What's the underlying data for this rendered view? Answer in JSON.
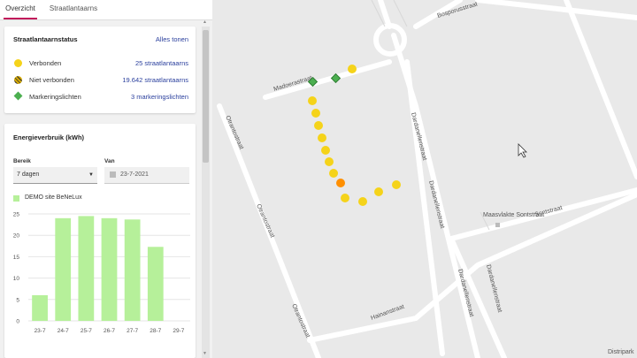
{
  "tabs": [
    {
      "label": "Overzicht",
      "active": true
    },
    {
      "label": "Straatlantaarns",
      "active": false
    }
  ],
  "status": {
    "title": "Straatlantaarnstatus",
    "show_all": "Alles tonen",
    "rows": [
      {
        "label": "Verbonden",
        "value": "25 straatlantaarns",
        "color": "#f5d31a"
      },
      {
        "label": "Niet verbonden",
        "value": "19.642 straatlantaarns",
        "color": "#c9a400"
      },
      {
        "label": "Markeringslichten",
        "value": "3 markeringslichten",
        "color": "#4caf50"
      }
    ]
  },
  "energy": {
    "title": "Energieverbruik (kWh)",
    "range_label": "Bereik",
    "range_value": "7 dagen",
    "from_label": "Van",
    "from_value": "23-7-2021",
    "legend": "DEMO site BeNeLux",
    "bar_color": "#b6f09a"
  },
  "chart_data": {
    "type": "bar",
    "categories": [
      "23-7",
      "24-7",
      "25-7",
      "26-7",
      "27-7",
      "28-7",
      "29-7"
    ],
    "series": [
      {
        "name": "DEMO site BeNeLux",
        "values": [
          6,
          24,
          24.5,
          24,
          23.7,
          17.3,
          0
        ]
      }
    ],
    "yticks": [
      "0",
      "5",
      "10",
      "15",
      "20",
      "25"
    ],
    "ylim": [
      0,
      25
    ]
  },
  "map": {
    "streets": [
      "Bosporusstraat",
      "Madoerastraat",
      "Otrantostraat",
      "Otrantostraat",
      "Otrantostraat",
      "Dardanellenstraat",
      "Dardanellenstraat",
      "Dardanellenstraat",
      "Dardanellenstraat",
      "Sontstraat",
      "Hainanstraat"
    ],
    "poi": "Maasvlakte Sontstraat",
    "watermark": "Distripark"
  }
}
